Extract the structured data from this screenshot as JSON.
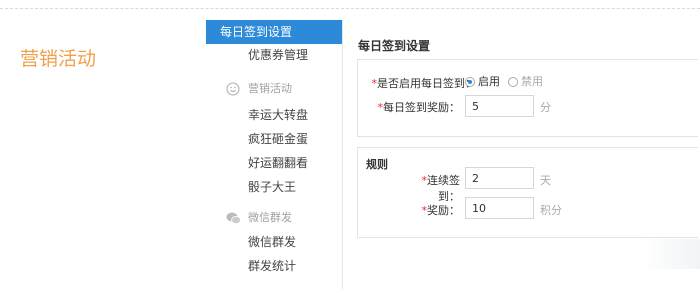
{
  "page": {
    "title": "营销活动"
  },
  "sidebar": {
    "items": [
      {
        "label": "每日签到设置",
        "active": true
      },
      {
        "label": "优惠券管理"
      }
    ],
    "groups": [
      {
        "label": "营销活动",
        "icon": "smiley-icon",
        "items": [
          "幸运大转盘",
          "疯狂砸金蛋",
          "好运翻翻看",
          "骰子大王"
        ]
      },
      {
        "label": "微信群发",
        "icon": "wechat-icon",
        "items": [
          "微信群发",
          "群发统计"
        ]
      }
    ]
  },
  "main": {
    "section_title": "每日签到设置",
    "enable": {
      "label": "是否启用每日签到：",
      "options": [
        "启用",
        "禁用"
      ],
      "selected": "启用"
    },
    "reward": {
      "label": "每日签到奖励：",
      "value": "5",
      "unit": "分"
    },
    "rules": {
      "heading": "规则",
      "streak": {
        "label": "连续签到：",
        "value": "2",
        "unit": "天"
      },
      "bonus": {
        "label": "奖励：",
        "value": "10",
        "unit": "积分"
      }
    }
  },
  "colors": {
    "accent": "#2d8ad8",
    "title": "#f0a04b",
    "required": "#e23"
  }
}
